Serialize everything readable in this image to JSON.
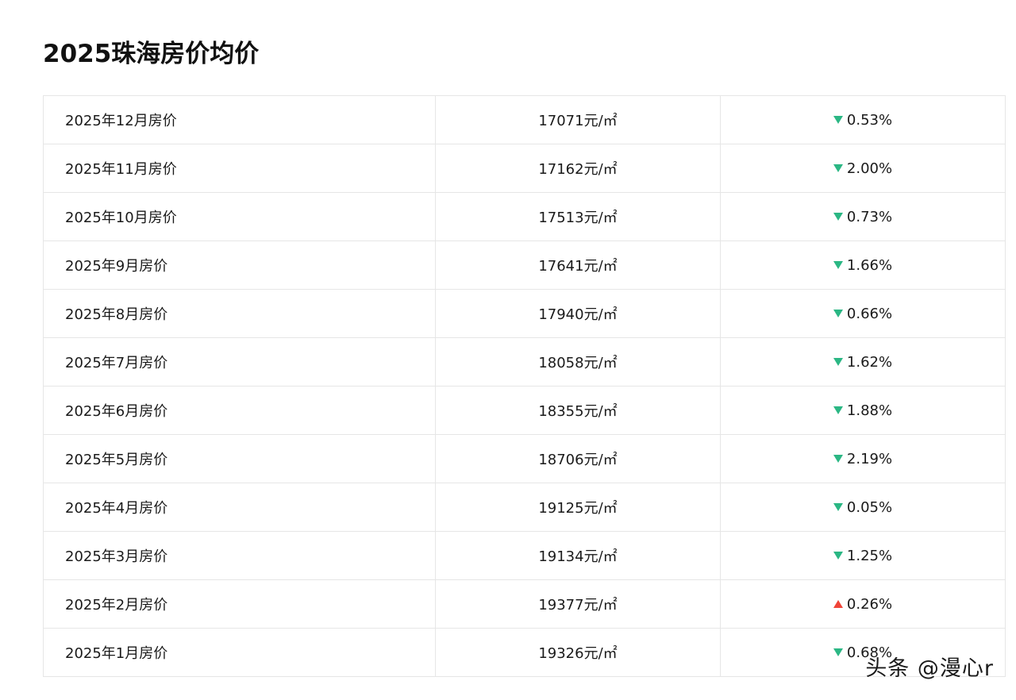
{
  "page": {
    "title": "2025珠海房价均价"
  },
  "table": {
    "rows": [
      {
        "month": "2025年12月房价",
        "price": "17071元/㎡",
        "change": "0.53%",
        "direction": "down"
      },
      {
        "month": "2025年11月房价",
        "price": "17162元/㎡",
        "change": "2.00%",
        "direction": "down"
      },
      {
        "month": "2025年10月房价",
        "price": "17513元/㎡",
        "change": "0.73%",
        "direction": "down"
      },
      {
        "month": "2025年9月房价",
        "price": "17641元/㎡",
        "change": "1.66%",
        "direction": "down"
      },
      {
        "month": "2025年8月房价",
        "price": "17940元/㎡",
        "change": "0.66%",
        "direction": "down"
      },
      {
        "month": "2025年7月房价",
        "price": "18058元/㎡",
        "change": "1.62%",
        "direction": "down"
      },
      {
        "month": "2025年6月房价",
        "price": "18355元/㎡",
        "change": "1.88%",
        "direction": "down"
      },
      {
        "month": "2025年5月房价",
        "price": "18706元/㎡",
        "change": "2.19%",
        "direction": "down"
      },
      {
        "month": "2025年4月房价",
        "price": "19125元/㎡",
        "change": "0.05%",
        "direction": "down"
      },
      {
        "month": "2025年3月房价",
        "price": "19134元/㎡",
        "change": "1.25%",
        "direction": "down"
      },
      {
        "month": "2025年2月房价",
        "price": "19377元/㎡",
        "change": "0.26%",
        "direction": "up"
      },
      {
        "month": "2025年1月房价",
        "price": "19326元/㎡",
        "change": "0.68%",
        "direction": "down"
      }
    ]
  },
  "icons": {
    "down": "triangle-down-icon",
    "up": "triangle-up-icon"
  },
  "colors": {
    "down": "#2bb784",
    "up": "#f04438"
  },
  "watermark": {
    "text": "头条 @漫心r"
  }
}
